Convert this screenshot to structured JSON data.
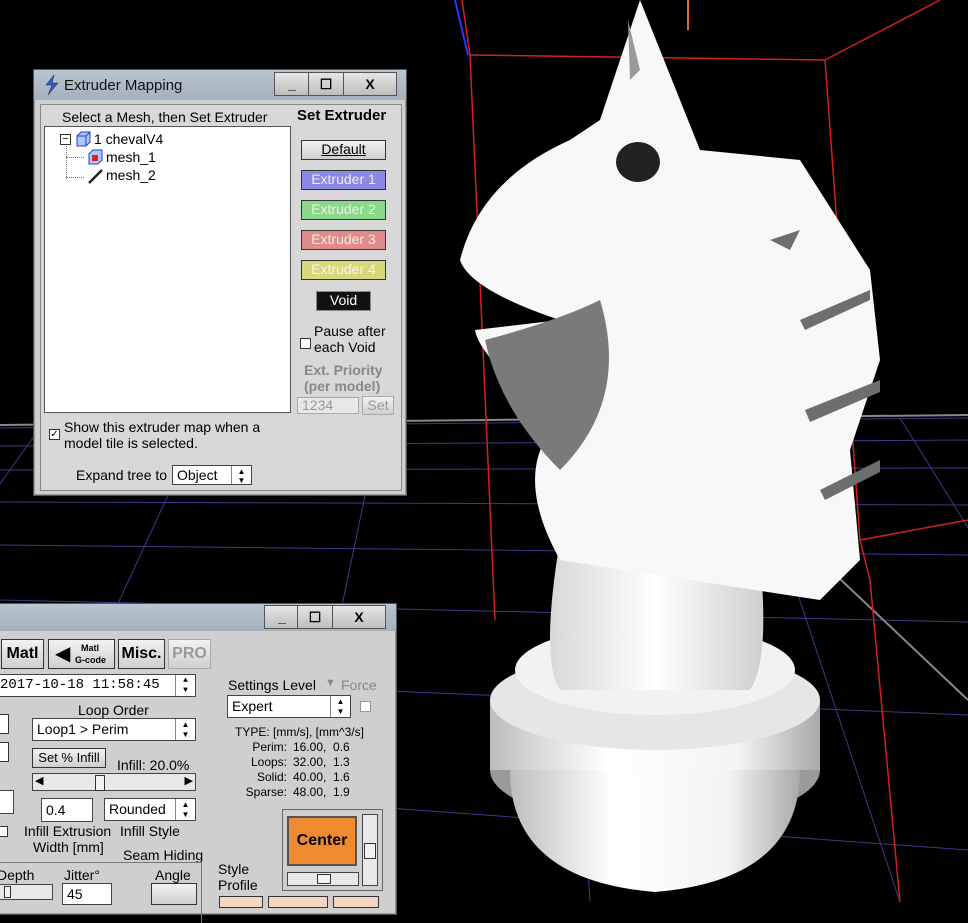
{
  "mapping_window": {
    "title": "Extruder Mapping",
    "controls": {
      "minimize": "_",
      "maximize": "☐",
      "close": "X"
    },
    "prompt": "Select a Mesh, then Set Extruder",
    "set_extruder_heading": "Set Extruder",
    "tree": {
      "root_toggle": "−",
      "root": "1 chevalV4",
      "children": [
        "mesh_1",
        "mesh_2"
      ]
    },
    "buttons": {
      "default": "Default",
      "extruder1": "Extruder 1",
      "extruder2": "Extruder 2",
      "extruder3": "Extruder 3",
      "extruder4": "Extruder 4",
      "void": "Void"
    },
    "pause_label": [
      "Pause after",
      "each Void"
    ],
    "ext_priority_label": [
      "Ext. Priority",
      "(per model)"
    ],
    "ext_priority_value": "1234",
    "set_button": "Set",
    "show_map_label": [
      "Show this extruder map when a",
      "model tile is selected."
    ],
    "show_map_checked": "✓",
    "expand_label": "Expand tree to",
    "expand_value": "Object",
    "colors": {
      "ext1": "#8a8ae6",
      "ext2": "#8ad88a",
      "ext3": "#e08a8a",
      "ext4": "#d8d87a"
    }
  },
  "process_window": {
    "controls": {
      "minimize": "_",
      "maximize": "☐",
      "close": "X"
    },
    "tabs": {
      "matl": "Matl",
      "matl_gcode_top": "Matl",
      "matl_gcode_bottom": "G-code",
      "misc": "Misc.",
      "pro": "PRO"
    },
    "profile_date": "2017-10-18 11:58:45",
    "loop_order_label": "Loop Order",
    "loop_order_value": "Loop1 > Perim",
    "set_infill_button": "Set % Infill",
    "infill_label": "Infill: 20.0%",
    "infill_width_value": "0.4",
    "infill_style_value": "Rounded",
    "infill_width_label": [
      "Infill Extrusion",
      "Width [mm]"
    ],
    "infill_style_label": "Infill Style",
    "seam_hiding_label": "Seam Hiding",
    "depth_label": "Depth",
    "jitter_label": "Jitter°",
    "jitter_value": "45",
    "angle_label": "Angle",
    "settings_level_label": "Settings Level",
    "force_label": "Force",
    "settings_level_value": "Expert",
    "type_header": "TYPE: [mm/s], [mm^3/s]",
    "speeds": [
      {
        "name": "Perim:",
        "values": "16.00,  0.6"
      },
      {
        "name": "Loops:",
        "values": "32.00,  1.3"
      },
      {
        "name": "Solid:",
        "values": "40.00,  1.6"
      },
      {
        "name": "Sparse:",
        "values": "48.00,  1.9"
      }
    ],
    "center_button": "Center",
    "style_profile_label": [
      "Style",
      "Profile"
    ],
    "colors": {
      "center": "#f08a30"
    }
  }
}
